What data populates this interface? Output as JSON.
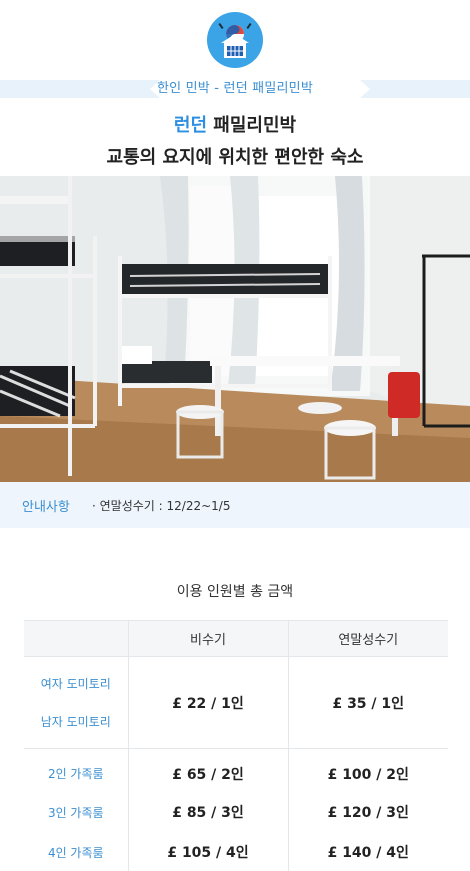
{
  "banner": {
    "text": "한인 민박 - 런던 패밀리민박"
  },
  "heading": {
    "accent": "런던",
    "rest": " 패밀리민박",
    "subtitle": "교통의 요지에 위치한 편안한 숙소"
  },
  "notice": {
    "label": "안내사항",
    "text": "· 연말성수기 : 12/22~1/5"
  },
  "pricing": {
    "title": "이용 인원별 총 금액",
    "columns": [
      "",
      "비수기",
      "연말성수기"
    ],
    "dorm": {
      "labels": [
        "여자 도미토리",
        "남자 도미토리"
      ],
      "off_season": "£ 22 / 1인",
      "peak_season": "£ 35 / 1인"
    },
    "family_rows": [
      {
        "label": "2인 가족룸",
        "off_season": "£ 65 / 2인",
        "peak_season": "£ 100 / 2인"
      },
      {
        "label": "3인 가족룸",
        "off_season": "£ 85 / 3인",
        "peak_season": "£ 120 / 3인"
      },
      {
        "label": "4인 가족룸",
        "off_season": "£ 105 / 4인",
        "peak_season": "£ 140 / 4인"
      }
    ]
  },
  "colors": {
    "accent": "#2e8fe0",
    "label_blue": "#3b8fd1",
    "banner_bg": "#e8f2fb",
    "logo_bg": "#3ba4e6"
  }
}
